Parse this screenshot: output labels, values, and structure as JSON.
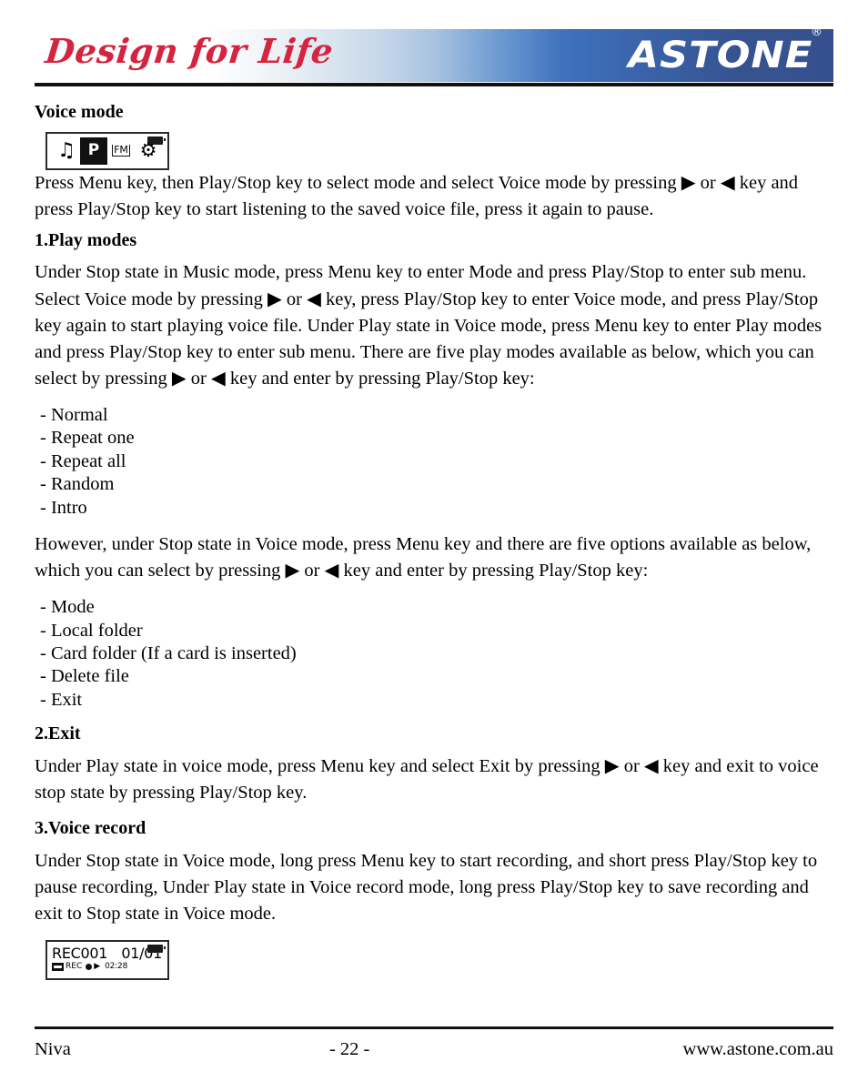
{
  "header": {
    "tagline": "Design for Life",
    "brand": "ASTONE",
    "registered_mark": "®"
  },
  "content": {
    "section_title": "Voice mode",
    "lcd_mode_screen": {
      "icons": [
        {
          "name": "music-note-icon",
          "glyph": "♫",
          "selected": false
        },
        {
          "name": "voice-record-icon",
          "glyph": "P",
          "selected": true
        },
        {
          "name": "fm-radio-icon",
          "glyph": "FM",
          "selected": false
        },
        {
          "name": "settings-gear-icon",
          "glyph": "⚙",
          "selected": false
        }
      ],
      "battery_icon": "battery-icon"
    },
    "intro_paragraph": "Press Menu key, then Play/Stop key to select mode and select Voice mode by pressing ▶ or ◀ key and press Play/Stop key to start listening to the saved voice file, press it again to pause.",
    "sections": [
      {
        "heading": "1.Play modes",
        "paragraph": "Under Stop state in Music mode, press Menu key to enter Mode and press Play/Stop to enter sub menu. Select Voice mode by pressing ▶ or ◀ key, press Play/Stop key to enter Voice mode, and press Play/Stop key again to start playing voice file. Under Play state in Voice mode, press Menu key to enter Play modes and press Play/Stop key to enter sub menu. There are five play modes available as below, which you can select by pressing ▶ or ◀ key and enter by pressing Play/Stop key:",
        "list": [
          "- Normal",
          "- Repeat one",
          "- Repeat all",
          "- Random",
          "- Intro"
        ],
        "paragraph_after": "However, under Stop state in Voice mode, press Menu key and there are five options available as below, which you can select by pressing ▶ or ◀ key and enter by pressing Play/Stop key:",
        "list_after": [
          "- Mode",
          "- Local folder",
          "- Card folder (If a card is inserted)",
          "- Delete file",
          "- Exit"
        ]
      },
      {
        "heading": "2.Exit",
        "paragraph": "Under Play state in voice mode, press Menu key and select Exit by pressing ▶ or ◀ key and exit to voice stop state by pressing Play/Stop key."
      },
      {
        "heading": "3.Voice record",
        "paragraph": "Under Stop state in Voice mode, long press Menu key to start recording, and short press Play/Stop key to pause recording, Under Play state in Voice record mode, long press Play/Stop key to save recording and exit to Stop state in Voice mode."
      }
    ],
    "lcd_rec_screen": {
      "file_name": "REC001",
      "track_counter": "01/01",
      "status_label": "REC",
      "elapsed_time": "02:28",
      "play_glyph": "▶",
      "battery_icon": "battery-icon",
      "tape_icon": "tape-icon",
      "record_dot_icon": "record-dot-icon"
    }
  },
  "footer": {
    "model": "Niva",
    "page_number": "- 22 -",
    "website": "www.astone.com.au"
  },
  "colors": {
    "brand_red": "#d5243f",
    "brand_blue": "#35508f",
    "rule": "#111111"
  }
}
